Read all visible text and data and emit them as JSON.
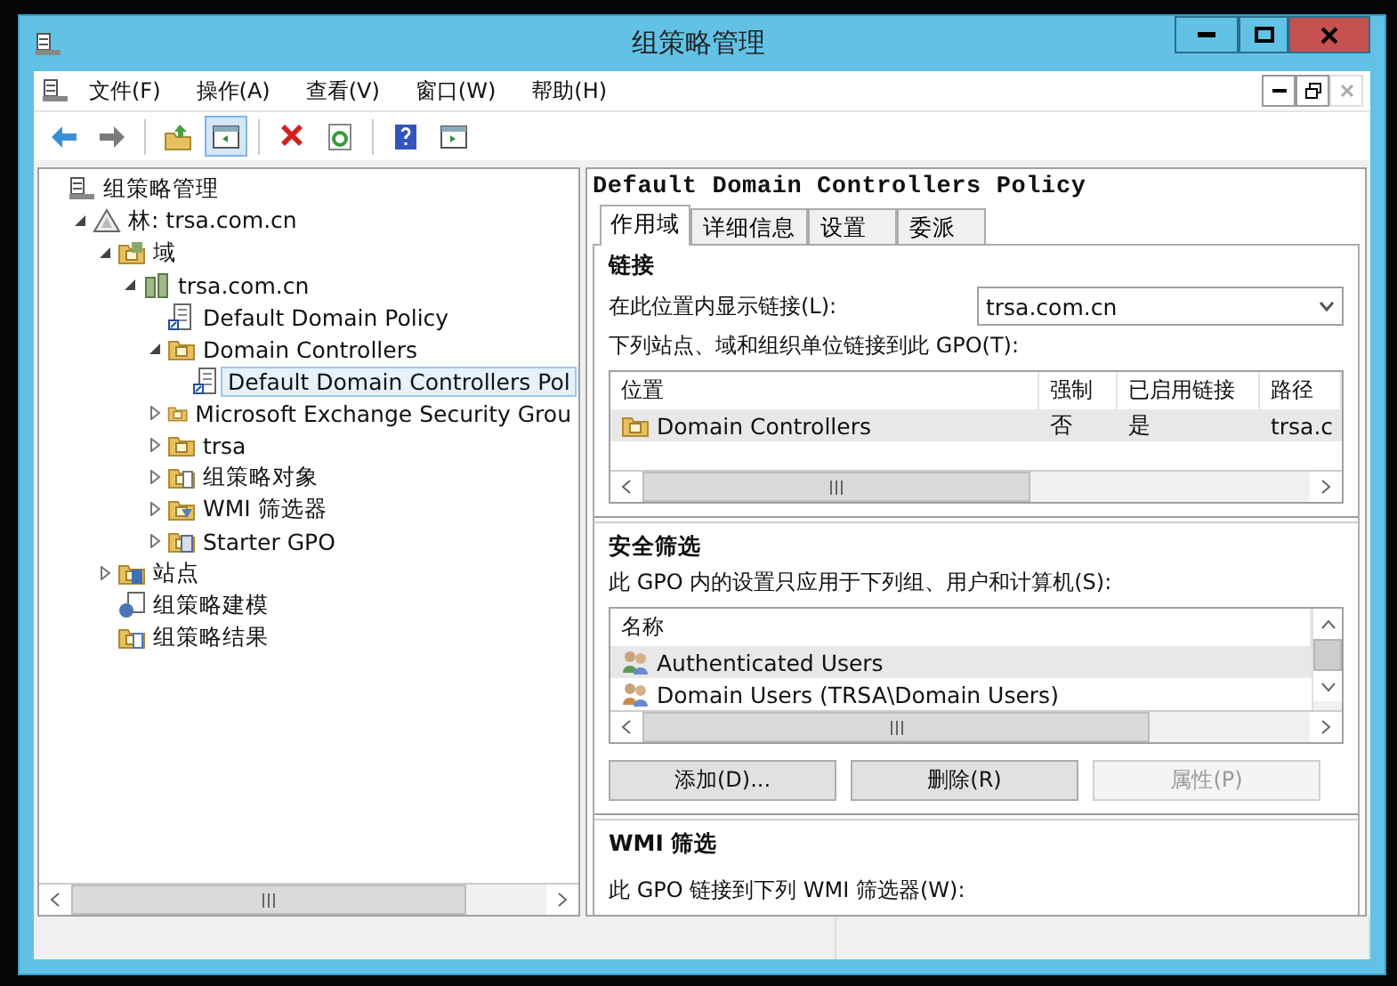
{
  "window": {
    "title": "组策略管理"
  },
  "menu": [
    "文件(F)",
    "操作(A)",
    "查看(V)",
    "窗口(W)",
    "帮助(H)"
  ],
  "toolbar": [
    {
      "kind": "back"
    },
    {
      "kind": "forward"
    },
    {
      "kind": "sep"
    },
    {
      "kind": "up"
    },
    {
      "kind": "tree",
      "pressed": true
    },
    {
      "kind": "sep"
    },
    {
      "kind": "delete"
    },
    {
      "kind": "refresh"
    },
    {
      "kind": "sep"
    },
    {
      "kind": "help"
    },
    {
      "kind": "pane"
    }
  ],
  "tree": [
    {
      "label": "组策略管理",
      "kind": "console",
      "selected": false,
      "children": [
        {
          "label": "林: trsa.com.cn",
          "kind": "forest",
          "expanded": true,
          "selected": false,
          "children": [
            {
              "label": "域",
              "kind": "domains",
              "expanded": true,
              "selected": false,
              "children": [
                {
                  "label": "trsa.com.cn",
                  "kind": "domain",
                  "expanded": true,
                  "selected": false,
                  "children": [
                    {
                      "label": "Default Domain Policy",
                      "kind": "link",
                      "selected": false
                    },
                    {
                      "label": "Domain Controllers",
                      "kind": "ou",
                      "expanded": true,
                      "selected": false,
                      "children": [
                        {
                          "label": "Default Domain Controllers Pol",
                          "kind": "link",
                          "selected": true
                        }
                      ]
                    },
                    {
                      "label": "Microsoft Exchange Security Grou",
                      "kind": "ou",
                      "expanded": false,
                      "selected": false
                    },
                    {
                      "label": "trsa",
                      "kind": "ou",
                      "expanded": false,
                      "selected": false
                    },
                    {
                      "label": "组策略对象",
                      "kind": "gpos",
                      "expanded": false,
                      "selected": false
                    },
                    {
                      "label": "WMI 筛选器",
                      "kind": "wmi",
                      "expanded": false,
                      "selected": false
                    },
                    {
                      "label": "Starter GPO",
                      "kind": "starter",
                      "expanded": false,
                      "selected": false
                    }
                  ]
                }
              ]
            },
            {
              "label": "站点",
              "kind": "sites",
              "expanded": false,
              "selected": false
            },
            {
              "label": "组策略建模",
              "kind": "modeling",
              "selected": false
            },
            {
              "label": "组策略结果",
              "kind": "results",
              "selected": false
            }
          ]
        }
      ]
    }
  ],
  "details": {
    "title": "Default Domain Controllers Policy",
    "tabs": [
      {
        "label": "作用域",
        "selected": true
      },
      {
        "label": "详细信息",
        "selected": false
      },
      {
        "label": "设置",
        "selected": false
      },
      {
        "label": "委派",
        "selected": false
      }
    ],
    "links": {
      "heading": "链接",
      "location_label": "在此位置内显示链接(L):",
      "location_value": "trsa.com.cn",
      "list_label": "下列站点、域和组织单位链接到此 GPO(T):",
      "columns": [
        "位置",
        "强制",
        "已启用链接",
        "路径"
      ],
      "rows": [
        {
          "cells": [
            "Domain Controllers",
            "否",
            "是",
            "trsa.c"
          ],
          "selected": true
        }
      ]
    },
    "security": {
      "heading": "安全筛选",
      "description": "此 GPO 内的设置只应用于下列组、用户和计算机(S):",
      "column": "名称",
      "rows": [
        {
          "name": "Authenticated Users",
          "selected": true
        },
        {
          "name": "Domain Users (TRSA\\Domain Users)",
          "selected": false
        }
      ],
      "buttons": [
        {
          "label": "添加(D)...",
          "disabled": false
        },
        {
          "label": "删除(R)",
          "disabled": false
        },
        {
          "label": "属性(P)",
          "disabled": true
        }
      ]
    },
    "wmi": {
      "heading": "WMI 筛选",
      "description": "此 GPO 链接到下列 WMI 筛选器(W):"
    }
  }
}
